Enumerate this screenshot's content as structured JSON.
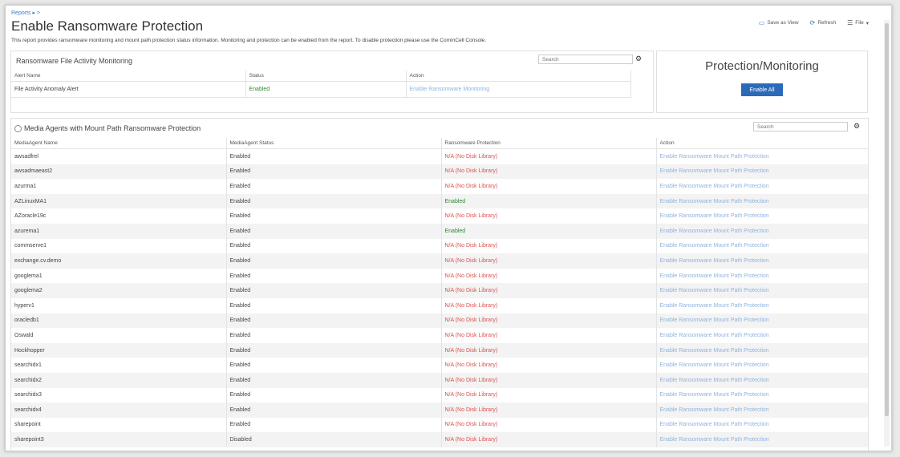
{
  "header": {
    "breadcrumb": "Reports ▸ >",
    "title": "Enable Ransomware Protection",
    "description": "This report provides ransomware monitoring and mount path protection status information. Monitoring and protection can be enabled from the report. To disable protection please use the CommCell Console.",
    "toolbar": {
      "save_as_view": "Save as View",
      "refresh": "Refresh",
      "file": "File"
    }
  },
  "file_activity": {
    "title": "Ransomware File Activity Monitoring",
    "search_placeholder": "Search",
    "columns": [
      "Alert Name",
      "Status",
      "Action"
    ],
    "rows": [
      {
        "name": "File Activity Anomaly Alert",
        "status": "Enabled",
        "action": "Enable Ransomware Monitoring"
      }
    ]
  },
  "protection_monitoring": {
    "title": "Protection/Monitoring",
    "button": "Enable All"
  },
  "media_agents": {
    "title": "Media Agents with Mount Path Ransomware Protection",
    "search_placeholder": "Search",
    "columns": [
      "MediaAgent Name",
      "MediaAgent Status",
      "Ransomware Protection",
      "Action"
    ],
    "rows": [
      {
        "name": "awsadfrel",
        "status": "Enabled",
        "protection": "N/A (No Disk Library)",
        "protection_state": "na",
        "action": "Enable Ransomware Mount Path Protection"
      },
      {
        "name": "awsadmaeast2",
        "status": "Enabled",
        "protection": "N/A (No Disk Library)",
        "protection_state": "na",
        "action": "Enable Ransomware Mount Path Protection"
      },
      {
        "name": "azurma1",
        "status": "Enabled",
        "protection": "N/A (No Disk Library)",
        "protection_state": "na",
        "action": "Enable Ransomware Mount Path Protection"
      },
      {
        "name": "AZLinuxMA1",
        "status": "Enabled",
        "protection": "Enabled",
        "protection_state": "enabled",
        "action": "Enable Ransomware Mount Path Protection"
      },
      {
        "name": "AZoracle19c",
        "status": "Enabled",
        "protection": "N/A (No Disk Library)",
        "protection_state": "na",
        "action": "Enable Ransomware Mount Path Protection"
      },
      {
        "name": "azurema1",
        "status": "Enabled",
        "protection": "Enabled",
        "protection_state": "enabled",
        "action": "Enable Ransomware Mount Path Protection"
      },
      {
        "name": "commserve1",
        "status": "Enabled",
        "protection": "N/A (No Disk Library)",
        "protection_state": "na",
        "action": "Enable Ransomware Mount Path Protection"
      },
      {
        "name": "exchange.cv.demo",
        "status": "Enabled",
        "protection": "N/A (No Disk Library)",
        "protection_state": "na",
        "action": "Enable Ransomware Mount Path Protection"
      },
      {
        "name": "googlema1",
        "status": "Enabled",
        "protection": "N/A (No Disk Library)",
        "protection_state": "na",
        "action": "Enable Ransomware Mount Path Protection"
      },
      {
        "name": "googlema2",
        "status": "Enabled",
        "protection": "N/A (No Disk Library)",
        "protection_state": "na",
        "action": "Enable Ransomware Mount Path Protection"
      },
      {
        "name": "hyperv1",
        "status": "Enabled",
        "protection": "N/A (No Disk Library)",
        "protection_state": "na",
        "action": "Enable Ransomware Mount Path Protection"
      },
      {
        "name": "oracledb1",
        "status": "Enabled",
        "protection": "N/A (No Disk Library)",
        "protection_state": "na",
        "action": "Enable Ransomware Mount Path Protection"
      },
      {
        "name": "Oswald",
        "status": "Enabled",
        "protection": "N/A (No Disk Library)",
        "protection_state": "na",
        "action": "Enable Ransomware Mount Path Protection"
      },
      {
        "name": "Hockhopper",
        "status": "Enabled",
        "protection": "N/A (No Disk Library)",
        "protection_state": "na",
        "action": "Enable Ransomware Mount Path Protection"
      },
      {
        "name": "searchidx1",
        "status": "Enabled",
        "protection": "N/A (No Disk Library)",
        "protection_state": "na",
        "action": "Enable Ransomware Mount Path Protection"
      },
      {
        "name": "searchidx2",
        "status": "Enabled",
        "protection": "N/A (No Disk Library)",
        "protection_state": "na",
        "action": "Enable Ransomware Mount Path Protection"
      },
      {
        "name": "searchidx3",
        "status": "Enabled",
        "protection": "N/A (No Disk Library)",
        "protection_state": "na",
        "action": "Enable Ransomware Mount Path Protection"
      },
      {
        "name": "searchidx4",
        "status": "Enabled",
        "protection": "N/A (No Disk Library)",
        "protection_state": "na",
        "action": "Enable Ransomware Mount Path Protection"
      },
      {
        "name": "sharepoint",
        "status": "Enabled",
        "protection": "N/A (No Disk Library)",
        "protection_state": "na",
        "action": "Enable Ransomware Mount Path Protection"
      },
      {
        "name": "sharepoint3",
        "status": "Disabled",
        "protection": "N/A (No Disk Library)",
        "protection_state": "na",
        "action": "Enable Ransomware Mount Path Protection"
      }
    ]
  },
  "colors": {
    "enabled": "#2e8b2e",
    "na": "#d9534f",
    "link": "#8fb3de",
    "button": "#2a6ab8"
  }
}
